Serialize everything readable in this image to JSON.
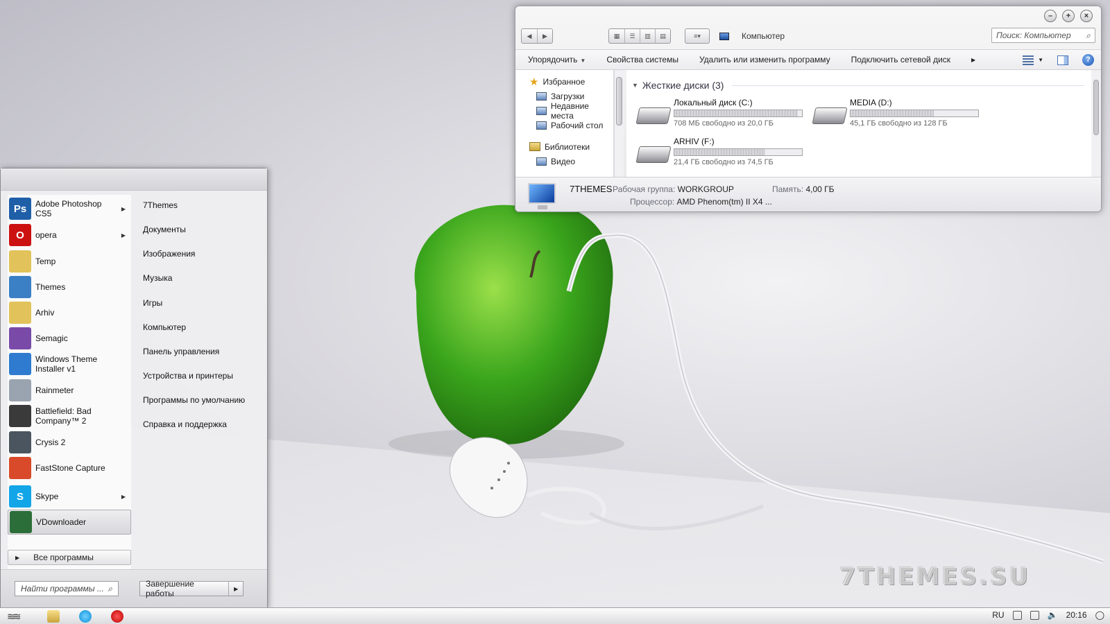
{
  "explorer": {
    "address": "Компьютер",
    "search_placeholder": "Поиск: Компьютер",
    "commands": [
      "Упорядочить",
      "Свойства системы",
      "Удалить или изменить программу",
      "Подключить сетевой диск"
    ],
    "nav": [
      {
        "label": "Избранное",
        "icon": "star-icon"
      },
      {
        "label": "Загрузки",
        "icon": "downloads-icon"
      },
      {
        "label": "Недавние места",
        "icon": "recent-places-icon"
      },
      {
        "label": "Рабочий стол",
        "icon": "desktop-icon"
      },
      {
        "label": "Библиотеки",
        "icon": "libraries-icon"
      },
      {
        "label": "Видео",
        "icon": "video-icon"
      }
    ],
    "group_header": "Жесткие диски (3)",
    "drives": [
      {
        "name": "Локальный диск (C:)",
        "free": "708 МБ свободно из 20,0 ГБ",
        "used_fraction": 0.965
      },
      {
        "name": "MEDIA (D:)",
        "free": "45,1 ГБ свободно из 128 ГБ",
        "used_fraction": 0.65
      },
      {
        "name": "ARHIV (F:)",
        "free": "21,4 ГБ свободно из 74,5 ГБ",
        "used_fraction": 0.71
      }
    ],
    "details": {
      "computer_name": "7THEMES",
      "workgroup_label": "Рабочая группа:",
      "workgroup_value": "WORKGROUP",
      "memory_label": "Память:",
      "memory_value": "4,00 ГБ",
      "cpu_label": "Процессор:",
      "cpu_value": "AMD Phenom(tm) II X4 ..."
    }
  },
  "start_menu": {
    "programs": [
      {
        "label": "Adobe Photoshop CS5",
        "icon": "photoshop-icon",
        "arrow": true,
        "color": "#1f5fa8",
        "glyph": "Ps"
      },
      {
        "label": "opera",
        "icon": "opera-icon",
        "arrow": true,
        "color": "#cc1111",
        "glyph": "O"
      },
      {
        "label": "Temp",
        "icon": "folder-icon",
        "arrow": false,
        "color": "#e2c25a",
        "glyph": ""
      },
      {
        "label": "Themes",
        "icon": "themes-icon",
        "arrow": false,
        "color": "#3b7fc4",
        "glyph": ""
      },
      {
        "label": "Arhiv",
        "icon": "folder-icon",
        "arrow": false,
        "color": "#e2c25a",
        "glyph": ""
      },
      {
        "label": "Semagic",
        "icon": "semagic-icon",
        "arrow": false,
        "color": "#7a4aa8",
        "glyph": ""
      },
      {
        "label": "Windows Theme Installer v1",
        "icon": "windows-theme-installer-icon",
        "arrow": false,
        "color": "#2e7bd0",
        "glyph": ""
      },
      {
        "label": "Rainmeter",
        "icon": "rainmeter-icon",
        "arrow": false,
        "color": "#9aa4b0",
        "glyph": ""
      },
      {
        "label": "Battlefield: Bad Company™ 2",
        "icon": "battlefield-icon",
        "arrow": false,
        "color": "#3a3a3a",
        "glyph": ""
      },
      {
        "label": "Crysis 2",
        "icon": "crysis-icon",
        "arrow": false,
        "color": "#4a5560",
        "glyph": ""
      },
      {
        "label": "FastStone Capture",
        "icon": "faststone-icon",
        "arrow": false,
        "color": "#d94a2a",
        "glyph": ""
      },
      {
        "label": "Skype",
        "icon": "skype-icon",
        "arrow": true,
        "color": "#12a5e8",
        "glyph": "S"
      },
      {
        "label": "VDownloader",
        "icon": "vdownloader-icon",
        "arrow": false,
        "color": "#2c6e3a",
        "glyph": ""
      }
    ],
    "all_programs": "Все программы",
    "places": [
      "7Themes",
      "Документы",
      "Изображения",
      "Музыка",
      "Игры",
      "Компьютер",
      "Панель управления",
      "Устройства и принтеры",
      "Программы по умолчанию",
      "Справка и поддержка"
    ],
    "search_placeholder": "Найти программы ...",
    "shutdown": "Завершение работы"
  },
  "taskbar": {
    "lang": "RU",
    "time": "20:16"
  },
  "wallpaper": {
    "watermark": "7THEMES.SU"
  }
}
